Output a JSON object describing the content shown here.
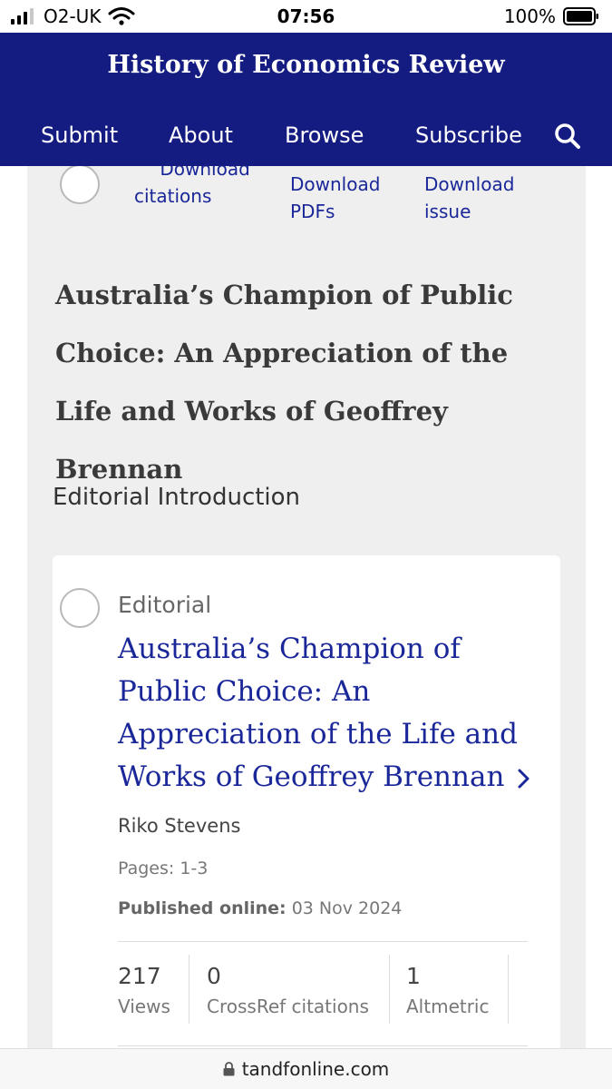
{
  "status_bar": {
    "carrier": "O2-UK",
    "time": "07:56",
    "battery": "100%",
    "icons": [
      "signal-icon",
      "wifi-icon",
      "battery-icon"
    ]
  },
  "header": {
    "site_title": "History of Economics Review",
    "nav": [
      "Submit",
      "About",
      "Browse",
      "Subscribe"
    ],
    "search_icon": "search-icon",
    "background_color": "#141c82"
  },
  "toolbar": {
    "download_citations": "Download citations",
    "download_pdfs": "Download PDFs",
    "download_issue": "Download issue",
    "quote_icon": "quote-icon"
  },
  "issue": {
    "title": "Australia’s Champion of Public Choice: An Appreciation of the Life and Works of Geoffrey Brennan"
  },
  "section": {
    "heading": "Editorial Introduction"
  },
  "article": {
    "type": "Editorial",
    "title": "Australia’s Champion of Public Choice: An Appreciation of the Life and Works of Geoffrey Brennan",
    "author": "Riko Stevens",
    "pages": "Pages: 1-3",
    "published_label": "Published online:",
    "published_date": "03 Nov 2024",
    "metrics": [
      {
        "value": "217",
        "label": "Views"
      },
      {
        "value": "0",
        "label": "CrossRef citations"
      },
      {
        "value": "1",
        "label": "Altmetric"
      }
    ],
    "link_color": "#1a2799"
  },
  "url_bar": {
    "url": "tandfonline.com",
    "lock_icon": "lock-icon"
  }
}
